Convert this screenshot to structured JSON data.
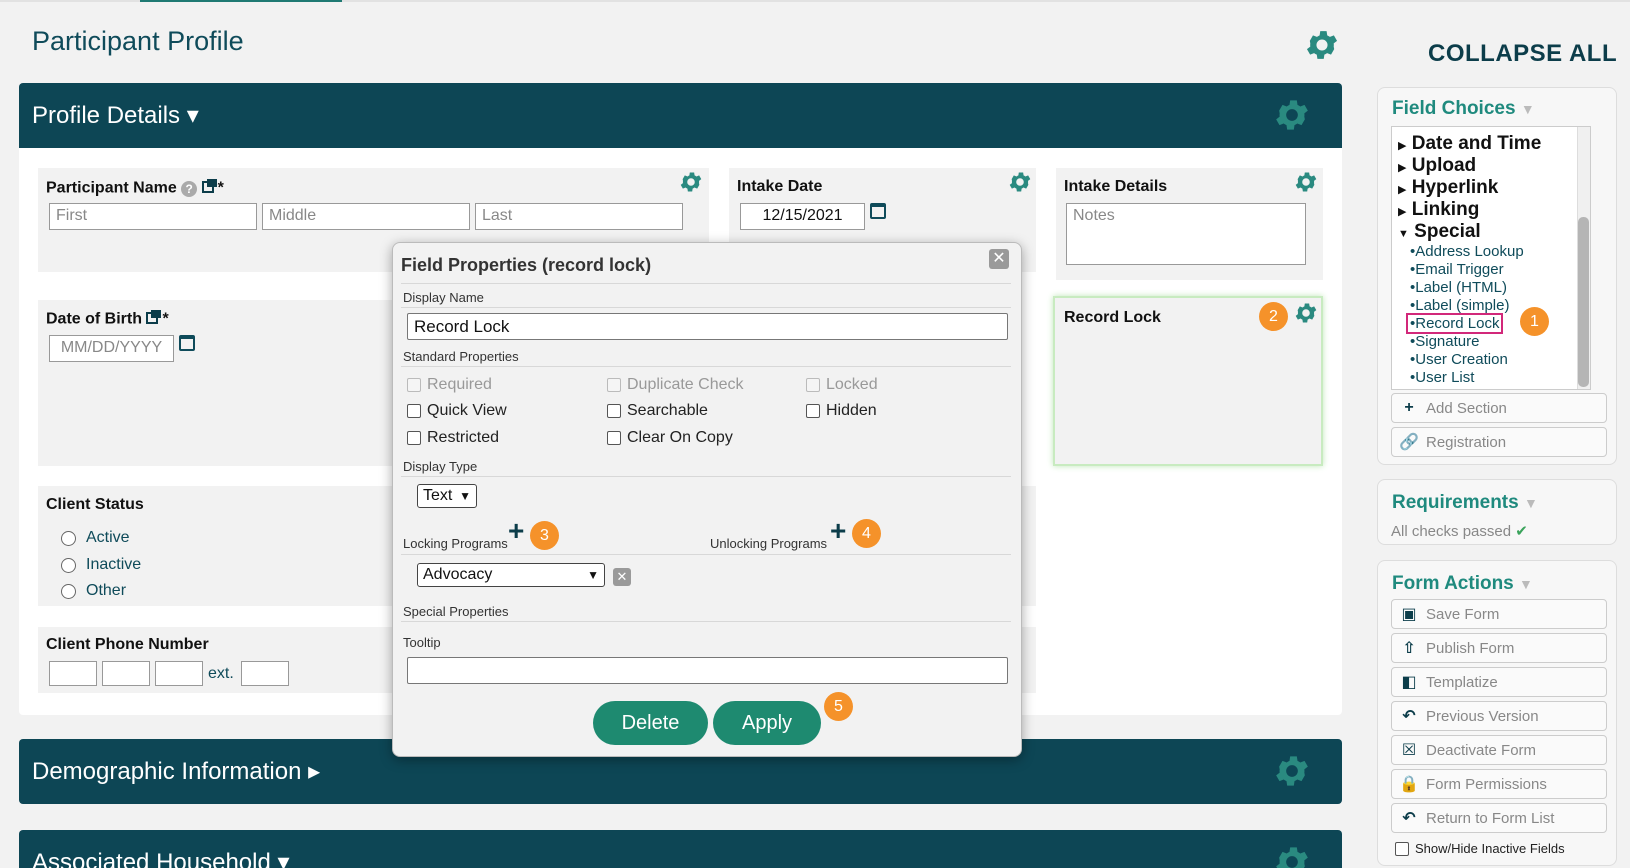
{
  "page": {
    "title": "Participant Profile",
    "collapse_all": "COLLAPSE ALL"
  },
  "profile_details": {
    "title": "Profile Details ▾",
    "participant_name": {
      "label": "Participant Name",
      "asterisk": "*",
      "first_placeholder": "First",
      "middle_placeholder": "Middle",
      "last_placeholder": "Last"
    },
    "intake_date": {
      "label": "Intake Date",
      "value": "12/15/2021"
    },
    "intake_details": {
      "label": "Intake Details",
      "placeholder": "Notes"
    },
    "date_of_birth": {
      "label": "Date of Birth",
      "asterisk": "*",
      "placeholder": "MM/DD/YYYY"
    },
    "record_lock": {
      "label": "Record Lock"
    },
    "client_status": {
      "label": "Client Status",
      "options": [
        "Active",
        "Inactive",
        "Other"
      ]
    },
    "client_phone": {
      "label": "Client Phone Number",
      "ext_label": "ext."
    }
  },
  "sections": {
    "demographic": "Demographic Information ▸",
    "household": "Associated Household ▾"
  },
  "modal": {
    "title": "Field Properties (record lock)",
    "close": "✕",
    "display_name_label": "Display Name",
    "display_name_value": "Record Lock",
    "standard_properties_label": "Standard Properties",
    "checkboxes": {
      "required": "Required",
      "duplicate_check": "Duplicate Check",
      "locked": "Locked",
      "quick_view": "Quick View",
      "searchable": "Searchable",
      "hidden": "Hidden",
      "restricted": "Restricted",
      "clear_on_copy": "Clear On Copy"
    },
    "display_type_label": "Display Type",
    "display_type_value": "Text",
    "locking_programs_label": "Locking Programs",
    "unlocking_programs_label": "Unlocking Programs",
    "locking_program_value": "Advocacy",
    "special_properties_label": "Special Properties",
    "tooltip_label": "Tooltip",
    "delete_label": "Delete",
    "apply_label": "Apply"
  },
  "badges": [
    "1",
    "2",
    "3",
    "4",
    "5"
  ],
  "sidebar": {
    "field_choices": {
      "title": "Field Choices",
      "categories": [
        "Date and Time",
        "Upload",
        "Hyperlink",
        "Linking",
        "Special"
      ],
      "special_items": [
        "•Address Lookup",
        "•Email Trigger",
        "•Label (HTML)",
        "•Label (simple)",
        "•Record Lock",
        "•Signature",
        "•User Creation",
        "•User List"
      ],
      "add_section": "Add Section",
      "registration": "Registration"
    },
    "requirements": {
      "title": "Requirements",
      "status": "All checks passed"
    },
    "form_actions": {
      "title": "Form Actions",
      "buttons": [
        "Save Form",
        "Publish Form",
        "Templatize",
        "Previous Version",
        "Deactivate Form",
        "Form Permissions",
        "Return to Form List"
      ],
      "show_hide": "Show/Hide Inactive Fields"
    }
  },
  "colors": {
    "header_bg": "#0d4655",
    "accent": "#1f8a7e",
    "badge": "#f5922a",
    "button": "#1e8a70"
  }
}
